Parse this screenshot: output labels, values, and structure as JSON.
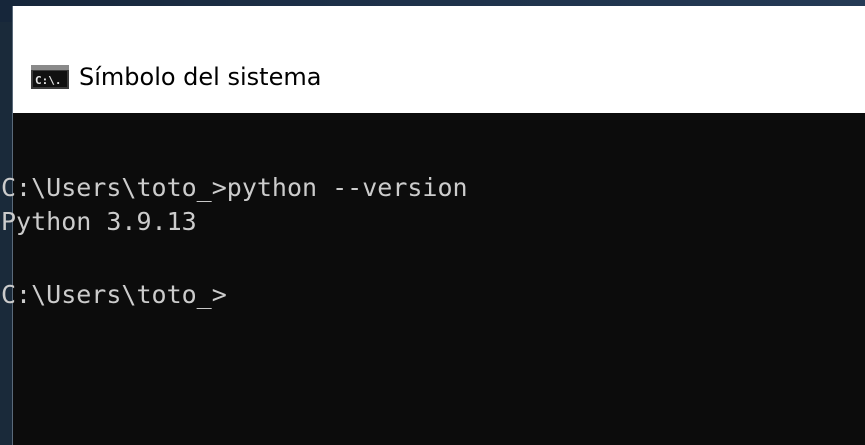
{
  "window": {
    "title": "Símbolo del sistema",
    "app_icon": "command-prompt-icon",
    "icon_text": "C:\\."
  },
  "console": {
    "lines": [
      "C:\\Users\\toto_>python --version",
      "Python 3.9.13",
      "",
      "C:\\Users\\toto_>"
    ]
  },
  "colors": {
    "console_background": "#0c0c0c",
    "console_text": "#cccccc",
    "titlebar_background": "#ffffff"
  }
}
